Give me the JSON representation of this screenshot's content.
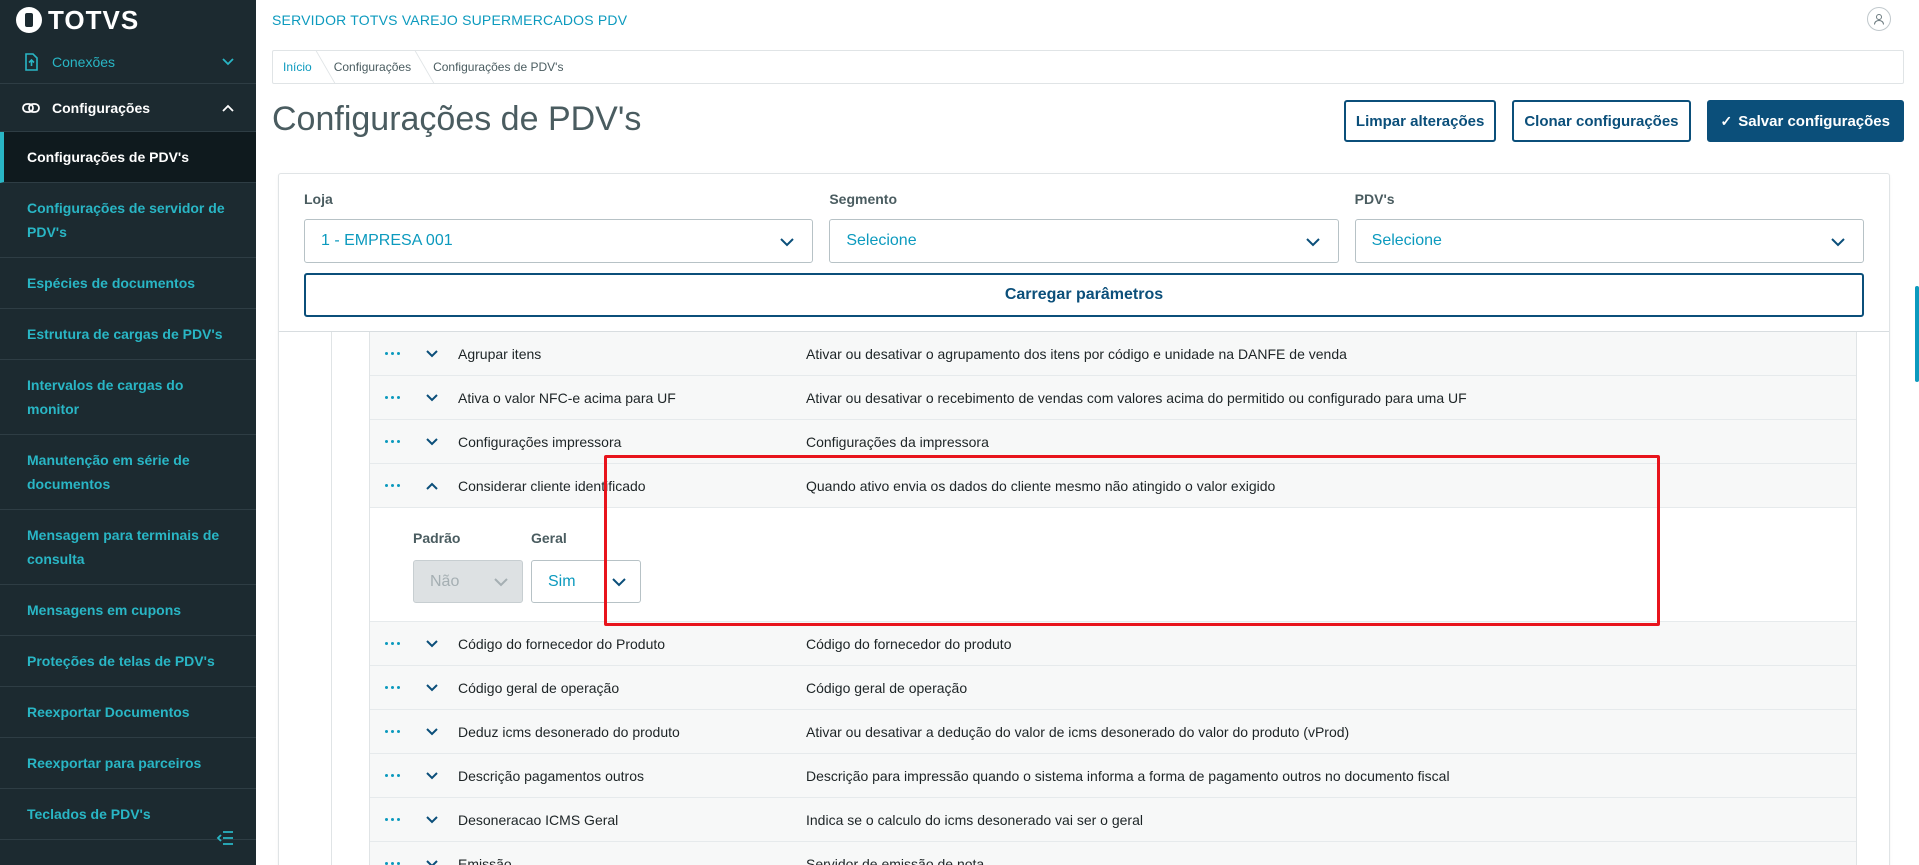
{
  "brand": {
    "name": "TOTVS"
  },
  "sidebar": {
    "groups": [
      {
        "label": "Conexões",
        "icon": "connection-icon",
        "expanded": false
      },
      {
        "label": "Configurações",
        "icon": "link-icon",
        "expanded": true
      }
    ],
    "items": [
      {
        "label": "Configurações de PDV's",
        "active": true
      },
      {
        "label": "Configurações de servidor de PDV's"
      },
      {
        "label": "Espécies de documentos"
      },
      {
        "label": "Estrutura de cargas de PDV's"
      },
      {
        "label": "Intervalos de cargas do monitor"
      },
      {
        "label": "Manutenção em série de documentos"
      },
      {
        "label": "Mensagem para terminais de consulta"
      },
      {
        "label": "Mensagens em cupons"
      },
      {
        "label": "Proteções de telas de PDV's"
      },
      {
        "label": "Reexportar Documentos"
      },
      {
        "label": "Reexportar para parceiros"
      },
      {
        "label": "Teclados de PDV's"
      }
    ]
  },
  "header": {
    "app_title": "SERVIDOR TOTVS VAREJO SUPERMERCADOS PDV"
  },
  "breadcrumb": [
    "Início",
    "Configurações",
    "Configurações de PDV's"
  ],
  "page": {
    "title": "Configurações de PDV's",
    "buttons": {
      "clear": "Limpar alterações",
      "clone": "Clonar configurações",
      "save": "Salvar configurações"
    }
  },
  "filters": {
    "loja": {
      "label": "Loja",
      "value": "1 - EMPRESA 001"
    },
    "segmento": {
      "label": "Segmento",
      "value": "Selecione"
    },
    "pdvs": {
      "label": "PDV's",
      "value": "Selecione"
    },
    "load_button": "Carregar parâmetros"
  },
  "params": [
    {
      "name": "Agrupar itens",
      "desc": "Ativar ou desativar o agrupamento dos itens por código e unidade na DANFE de venda"
    },
    {
      "name": "Ativa o valor NFC-e acima para UF",
      "desc": "Ativar ou desativar o recebimento de vendas com valores acima do permitido ou configurado para uma UF"
    },
    {
      "name": "Configurações impressora",
      "desc": "Configurações da impressora"
    },
    {
      "name": "Considerar cliente identificado",
      "desc": "Quando ativo envia os dados do cliente mesmo não atingido o valor exigido",
      "expanded": true
    },
    {
      "name": "Código do fornecedor do Produto",
      "desc": "Código do fornecedor do produto"
    },
    {
      "name": "Código geral de operação",
      "desc": "Código geral de operação"
    },
    {
      "name": "Deduz icms desonerado do produto",
      "desc": "Ativar ou desativar a dedução do valor de icms desonerado do valor do produto (vProd)"
    },
    {
      "name": "Descrição pagamentos outros",
      "desc": "Descrição para impressão quando o sistema informa a forma de pagamento outros no documento fiscal"
    },
    {
      "name": "Desoneracao ICMS Geral",
      "desc": "Indica se o calculo do icms desonerado vai ser o geral"
    },
    {
      "name": "Emissão",
      "desc": "Servidor de emissão de nota"
    }
  ],
  "expanded_detail": {
    "padrao": {
      "label": "Padrão",
      "value": "Não"
    },
    "geral": {
      "label": "Geral",
      "value": "Sim"
    }
  },
  "colors": {
    "sidebar_bg": "#1c2a30",
    "accent": "#0c9abe",
    "primary": "#0b4f7a",
    "highlight": "#e8141c"
  }
}
